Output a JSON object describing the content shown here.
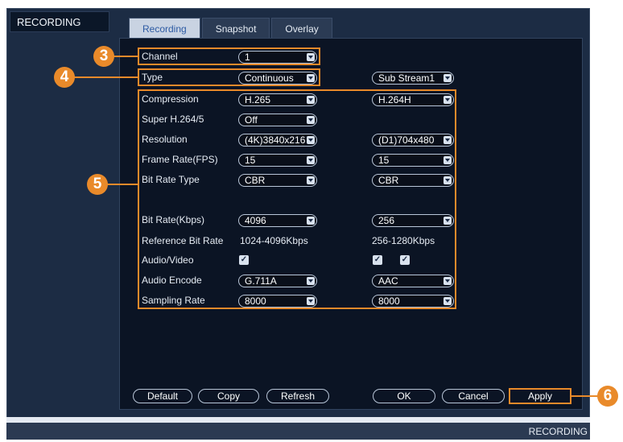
{
  "window": {
    "title": "RECORDING",
    "status_text": "RECORDING"
  },
  "tabs": [
    {
      "label": "Recording",
      "active": true
    },
    {
      "label": "Snapshot",
      "active": false
    },
    {
      "label": "Overlay",
      "active": false
    }
  ],
  "callouts": {
    "channel": "3",
    "type": "4",
    "settings": "5",
    "apply": "6"
  },
  "form": {
    "channel": {
      "label": "Channel",
      "value": "1"
    },
    "type": {
      "label": "Type",
      "value": "Continuous",
      "substream": "Sub Stream1"
    },
    "rows": {
      "compression": {
        "label": "Compression",
        "main": "H.265",
        "sub": "H.264H"
      },
      "super": {
        "label": "Super H.264/5",
        "main": "Off"
      },
      "resolution": {
        "label": "Resolution",
        "main": "(4K)3840x216",
        "sub": "(D1)704x480"
      },
      "framerate": {
        "label": "Frame Rate(FPS)",
        "main": "15",
        "sub": "15"
      },
      "bitratetype": {
        "label": "Bit Rate Type",
        "main": "CBR",
        "sub": "CBR"
      },
      "bitrate": {
        "label": "Bit Rate(Kbps)",
        "main": "4096",
        "sub": "256"
      },
      "reference": {
        "label": "Reference Bit Rate",
        "main": "1024-4096Kbps",
        "sub": "256-1280Kbps"
      },
      "audiovideo": {
        "label": "Audio/Video",
        "main_checked": true,
        "sub_checked": [
          true,
          true
        ]
      },
      "audioencode": {
        "label": "Audio Encode",
        "main": "G.711A",
        "sub": "AAC"
      },
      "samplingrate": {
        "label": "Sampling Rate",
        "main": "8000",
        "sub": "8000"
      }
    }
  },
  "buttons": {
    "default": "Default",
    "copy": "Copy",
    "refresh": "Refresh",
    "ok": "OK",
    "cancel": "Cancel",
    "apply": "Apply"
  },
  "colors": {
    "accent": "#e98a2a",
    "panel": "#0b1424",
    "window": "#1c2c44"
  }
}
